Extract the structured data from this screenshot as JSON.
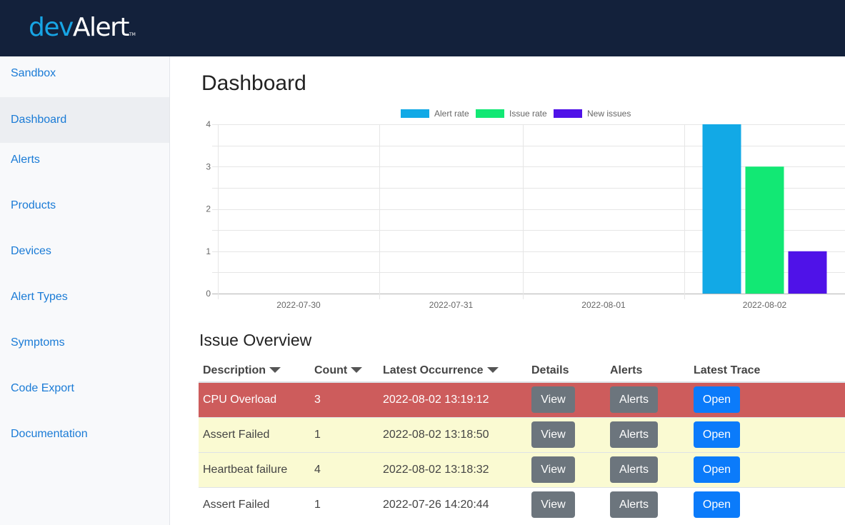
{
  "brand": {
    "dev": "dev",
    "alert": "Alert",
    "tm": "TM"
  },
  "sidebar": {
    "items": [
      {
        "label": "Sandbox"
      },
      {
        "label": "Dashboard",
        "active": true
      },
      {
        "label": "Alerts"
      },
      {
        "label": "Products"
      },
      {
        "label": "Devices"
      },
      {
        "label": "Alert Types"
      },
      {
        "label": "Symptoms"
      },
      {
        "label": "Code Export"
      },
      {
        "label": "Documentation"
      }
    ]
  },
  "page": {
    "title": "Dashboard"
  },
  "chart_data": {
    "type": "bar",
    "categories": [
      "2022-07-30",
      "2022-07-31",
      "2022-08-01",
      "2022-08-02"
    ],
    "series": [
      {
        "name": "Alert rate",
        "color": "#12a9e6",
        "values": [
          0,
          0,
          0,
          4
        ]
      },
      {
        "name": "Issue rate",
        "color": "#12e874",
        "values": [
          0,
          0,
          0,
          3
        ]
      },
      {
        "name": "New issues",
        "color": "#4f12e8",
        "values": [
          0,
          0,
          0,
          1
        ]
      }
    ],
    "ylim": [
      0,
      4
    ],
    "yticks": [
      0,
      1,
      2,
      3,
      4
    ],
    "legend": "top-center",
    "grid": true
  },
  "overview": {
    "title": "Issue Overview",
    "columns": {
      "description": "Description",
      "count": "Count",
      "latest": "Latest Occurrence",
      "details": "Details",
      "alerts": "Alerts",
      "trace": "Latest Trace"
    },
    "buttons": {
      "view": "View",
      "alerts": "Alerts",
      "open": "Open"
    },
    "rows": [
      {
        "description": "CPU Overload",
        "count": "3",
        "latest": "2022-08-02 13:19:12",
        "status": "danger"
      },
      {
        "description": "Assert Failed",
        "count": "1",
        "latest": "2022-08-02 13:18:50",
        "status": "warning"
      },
      {
        "description": "Heartbeat failure",
        "count": "4",
        "latest": "2022-08-02 13:18:32",
        "status": "warning"
      },
      {
        "description": "Assert Failed",
        "count": "1",
        "latest": "2022-07-26 14:20:44",
        "status": "normal"
      }
    ]
  }
}
